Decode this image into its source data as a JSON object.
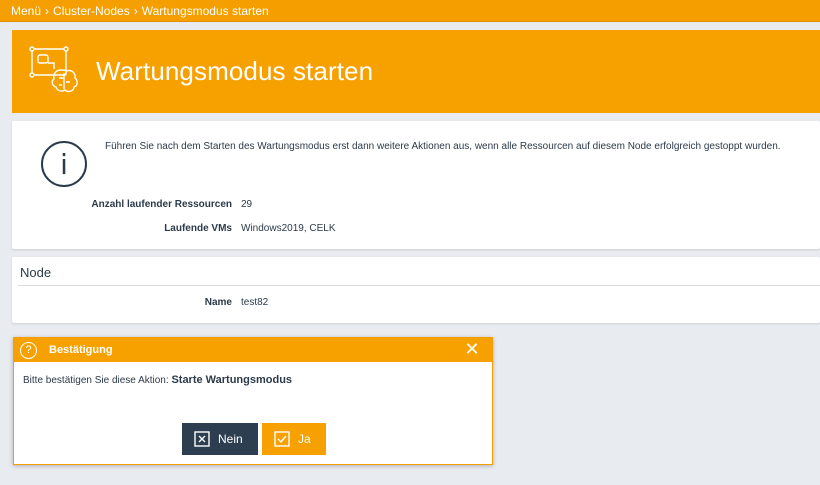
{
  "breadcrumb": {
    "items": [
      "Menü",
      "Cluster-Nodes",
      "Wartungsmodus starten"
    ],
    "separator": "›"
  },
  "header": {
    "title": "Wartungsmodus starten",
    "icon": "cluster-brain-icon"
  },
  "info": {
    "message": "Führen Sie nach dem Starten des Wartungsmodus erst dann weitere Aktionen aus, wenn alle Ressourcen auf diesem Node erfolgreich gestoppt wurden.",
    "rows": [
      {
        "label": "Anzahl laufender Ressourcen",
        "value": "29"
      },
      {
        "label": "Laufende VMs",
        "value": "Windows2019, CELK"
      }
    ]
  },
  "node": {
    "section_title": "Node",
    "rows": [
      {
        "label": "Name",
        "value": "test82"
      }
    ]
  },
  "dialog": {
    "title": "Bestätigung",
    "message_prefix": "Bitte bestätigen Sie diese Aktion:",
    "message_action": "Starte Wartungsmodus",
    "no_label": "Nein",
    "yes_label": "Ja"
  },
  "colors": {
    "accent": "#f7a100",
    "dark": "#2c3e50",
    "background": "#e8ebef"
  }
}
